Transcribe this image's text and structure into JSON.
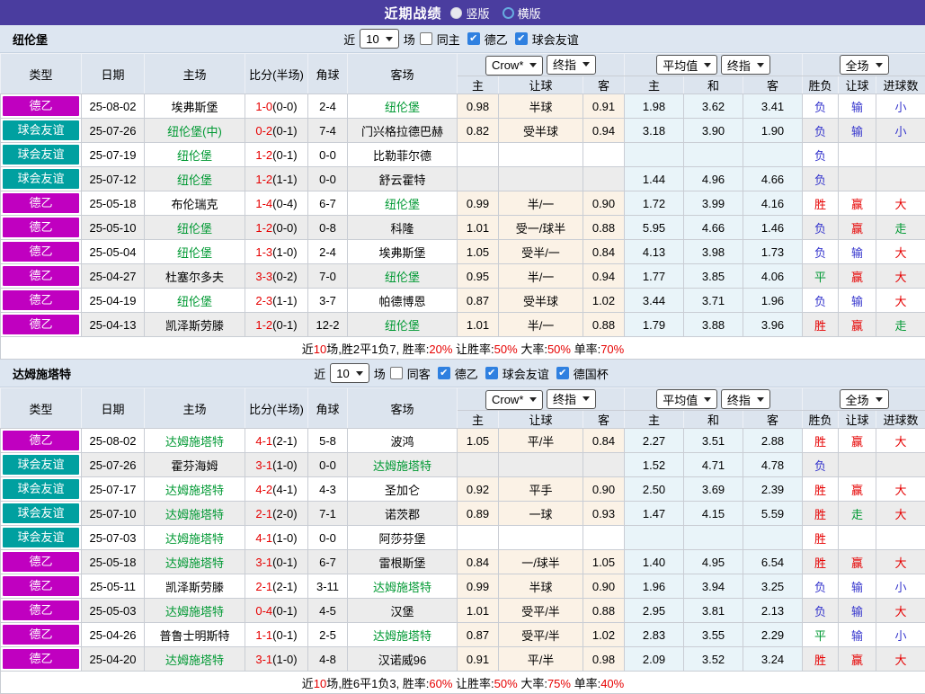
{
  "header": {
    "title": "近期战绩",
    "radios": [
      {
        "label": "竖版",
        "checked": true
      },
      {
        "label": "横版",
        "checked": false
      }
    ]
  },
  "colors": {
    "topbar": "#4a3d9f",
    "band_bg": "#dde6f1",
    "header_bg": "#dce4ee",
    "score_red": "#e60000",
    "team_green": "#009933",
    "win_red": "#e60000",
    "lose_blue": "#3535cd",
    "draw_green": "#009933",
    "odds_cream_bg": "#fbf2e6",
    "avg_blue_bg": "#e9f4f9"
  },
  "league_colors": {
    "德乙": "#c000c0",
    "球会友谊": "#00a0a0"
  },
  "columns": {
    "left": [
      "类型",
      "日期",
      "主场",
      "比分(半场)",
      "角球",
      "客场"
    ],
    "group1": [
      "主",
      "让球",
      "客"
    ],
    "group2": [
      "主",
      "和",
      "客"
    ],
    "group3": [
      "胜负",
      "让球",
      "进球数"
    ]
  },
  "sections": [
    {
      "team": "纽伦堡",
      "controls": {
        "near": "近",
        "count": "10",
        "unit": "场"
      },
      "checkboxes": [
        {
          "label": "同主",
          "checked": false
        },
        {
          "label": "德乙",
          "checked": true
        },
        {
          "label": "球会友谊",
          "checked": true
        }
      ],
      "dropdowns": {
        "book": "Crow*",
        "final1": "终指",
        "avg": "平均值",
        "final2": "终指",
        "full": "全场"
      },
      "rows": [
        {
          "lg": "德乙",
          "dt": "25-08-02",
          "hm": "埃弗斯堡",
          "hg": false,
          "fs": "1-0",
          "hf": "(0-0)",
          "cn": "2-4",
          "aw": "纽伦堡",
          "ag": true,
          "o1": "0.98",
          "hd": "半球",
          "o2": "0.91",
          "a1": "1.98",
          "a2": "3.62",
          "a3": "3.41",
          "w": "负",
          "wc": "b",
          "h": "输",
          "hc": "b",
          "g": "小",
          "gc": "b"
        },
        {
          "lg": "球会友谊",
          "dt": "25-07-26",
          "hm": "纽伦堡(中)",
          "hg": true,
          "fs": "0-2",
          "hf": "(0-1)",
          "cn": "7-4",
          "aw": "门兴格拉德巴赫",
          "ag": false,
          "o1": "0.82",
          "hd": "受半球",
          "o2": "0.94",
          "a1": "3.18",
          "a2": "3.90",
          "a3": "1.90",
          "w": "负",
          "wc": "b",
          "h": "输",
          "hc": "b",
          "g": "小",
          "gc": "b"
        },
        {
          "lg": "球会友谊",
          "dt": "25-07-19",
          "hm": "纽伦堡",
          "hg": true,
          "fs": "1-2",
          "hf": "(0-1)",
          "cn": "0-0",
          "aw": "比勒菲尔德",
          "ag": false,
          "o1": "",
          "hd": "",
          "o2": "",
          "a1": "",
          "a2": "",
          "a3": "",
          "w": "负",
          "wc": "b",
          "h": "",
          "hc": "",
          "g": "",
          "gc": ""
        },
        {
          "lg": "球会友谊",
          "dt": "25-07-12",
          "hm": "纽伦堡",
          "hg": true,
          "fs": "1-2",
          "hf": "(1-1)",
          "cn": "0-0",
          "aw": "舒云霍特",
          "ag": false,
          "o1": "",
          "hd": "",
          "o2": "",
          "a1": "1.44",
          "a2": "4.96",
          "a3": "4.66",
          "w": "负",
          "wc": "b",
          "h": "",
          "hc": "",
          "g": "",
          "gc": ""
        },
        {
          "lg": "德乙",
          "dt": "25-05-18",
          "hm": "布伦瑞克",
          "hg": false,
          "fs": "1-4",
          "hf": "(0-4)",
          "cn": "6-7",
          "aw": "纽伦堡",
          "ag": true,
          "o1": "0.99",
          "hd": "半/一",
          "o2": "0.90",
          "a1": "1.72",
          "a2": "3.99",
          "a3": "4.16",
          "w": "胜",
          "wc": "r",
          "h": "赢",
          "hc": "r",
          "g": "大",
          "gc": "r"
        },
        {
          "lg": "德乙",
          "dt": "25-05-10",
          "hm": "纽伦堡",
          "hg": true,
          "fs": "1-2",
          "hf": "(0-0)",
          "cn": "0-8",
          "aw": "科隆",
          "ag": false,
          "o1": "1.01",
          "hd": "受一/球半",
          "o2": "0.88",
          "a1": "5.95",
          "a2": "4.66",
          "a3": "1.46",
          "w": "负",
          "wc": "b",
          "h": "赢",
          "hc": "r",
          "g": "走",
          "gc": "g"
        },
        {
          "lg": "德乙",
          "dt": "25-05-04",
          "hm": "纽伦堡",
          "hg": true,
          "fs": "1-3",
          "hf": "(1-0)",
          "cn": "2-4",
          "aw": "埃弗斯堡",
          "ag": false,
          "o1": "1.05",
          "hd": "受半/一",
          "o2": "0.84",
          "a1": "4.13",
          "a2": "3.98",
          "a3": "1.73",
          "w": "负",
          "wc": "b",
          "h": "输",
          "hc": "b",
          "g": "大",
          "gc": "r"
        },
        {
          "lg": "德乙",
          "dt": "25-04-27",
          "hm": "杜塞尔多夫",
          "hg": false,
          "fs": "3-3",
          "hf": "(0-2)",
          "cn": "7-0",
          "aw": "纽伦堡",
          "ag": true,
          "o1": "0.95",
          "hd": "半/一",
          "o2": "0.94",
          "a1": "1.77",
          "a2": "3.85",
          "a3": "4.06",
          "w": "平",
          "wc": "g",
          "h": "赢",
          "hc": "r",
          "g": "大",
          "gc": "r"
        },
        {
          "lg": "德乙",
          "dt": "25-04-19",
          "hm": "纽伦堡",
          "hg": true,
          "fs": "2-3",
          "hf": "(1-1)",
          "cn": "3-7",
          "aw": "帕德博恩",
          "ag": false,
          "o1": "0.87",
          "hd": "受半球",
          "o2": "1.02",
          "a1": "3.44",
          "a2": "3.71",
          "a3": "1.96",
          "w": "负",
          "wc": "b",
          "h": "输",
          "hc": "b",
          "g": "大",
          "gc": "r"
        },
        {
          "lg": "德乙",
          "dt": "25-04-13",
          "hm": "凯泽斯劳滕",
          "hg": false,
          "fs": "1-2",
          "hf": "(0-1)",
          "cn": "12-2",
          "aw": "纽伦堡",
          "ag": true,
          "o1": "1.01",
          "hd": "半/一",
          "o2": "0.88",
          "a1": "1.79",
          "a2": "3.88",
          "a3": "3.96",
          "w": "胜",
          "wc": "r",
          "h": "赢",
          "hc": "r",
          "g": "走",
          "gc": "g"
        }
      ],
      "summary": [
        {
          "t": "近"
        },
        {
          "t": "10",
          "r": true
        },
        {
          "t": "场,胜2平1负7, 胜率:"
        },
        {
          "t": "20%",
          "r": true
        },
        {
          "t": " 让胜率:"
        },
        {
          "t": "50%",
          "r": true
        },
        {
          "t": " 大率:"
        },
        {
          "t": "50%",
          "r": true
        },
        {
          "t": " 单率:"
        },
        {
          "t": "70%",
          "r": true
        }
      ]
    },
    {
      "team": "达姆施塔特",
      "controls": {
        "near": "近",
        "count": "10",
        "unit": "场"
      },
      "checkboxes": [
        {
          "label": "同客",
          "checked": false
        },
        {
          "label": "德乙",
          "checked": true
        },
        {
          "label": "球会友谊",
          "checked": true
        },
        {
          "label": "德国杯",
          "checked": true
        }
      ],
      "dropdowns": {
        "book": "Crow*",
        "final1": "终指",
        "avg": "平均值",
        "final2": "终指",
        "full": "全场"
      },
      "rows": [
        {
          "lg": "德乙",
          "dt": "25-08-02",
          "hm": "达姆施塔特",
          "hg": true,
          "fs": "4-1",
          "hf": "(2-1)",
          "cn": "5-8",
          "aw": "波鸿",
          "ag": false,
          "o1": "1.05",
          "hd": "平/半",
          "o2": "0.84",
          "a1": "2.27",
          "a2": "3.51",
          "a3": "2.88",
          "w": "胜",
          "wc": "r",
          "h": "赢",
          "hc": "r",
          "g": "大",
          "gc": "r"
        },
        {
          "lg": "球会友谊",
          "dt": "25-07-26",
          "hm": "霍芬海姆",
          "hg": false,
          "fs": "3-1",
          "hf": "(1-0)",
          "cn": "0-0",
          "aw": "达姆施塔特",
          "ag": true,
          "o1": "",
          "hd": "",
          "o2": "",
          "a1": "1.52",
          "a2": "4.71",
          "a3": "4.78",
          "w": "负",
          "wc": "b",
          "h": "",
          "hc": "",
          "g": "",
          "gc": ""
        },
        {
          "lg": "球会友谊",
          "dt": "25-07-17",
          "hm": "达姆施塔特",
          "hg": true,
          "fs": "4-2",
          "hf": "(4-1)",
          "cn": "4-3",
          "aw": "圣加仑",
          "ag": false,
          "o1": "0.92",
          "hd": "平手",
          "o2": "0.90",
          "a1": "2.50",
          "a2": "3.69",
          "a3": "2.39",
          "w": "胜",
          "wc": "r",
          "h": "赢",
          "hc": "r",
          "g": "大",
          "gc": "r"
        },
        {
          "lg": "球会友谊",
          "dt": "25-07-10",
          "hm": "达姆施塔特",
          "hg": true,
          "fs": "2-1",
          "hf": "(2-0)",
          "cn": "7-1",
          "aw": "诺茨郡",
          "ag": false,
          "o1": "0.89",
          "hd": "一球",
          "o2": "0.93",
          "a1": "1.47",
          "a2": "4.15",
          "a3": "5.59",
          "w": "胜",
          "wc": "r",
          "h": "走",
          "hc": "g",
          "g": "大",
          "gc": "r"
        },
        {
          "lg": "球会友谊",
          "dt": "25-07-03",
          "hm": "达姆施塔特",
          "hg": true,
          "fs": "4-1",
          "hf": "(1-0)",
          "cn": "0-0",
          "aw": "阿莎芬堡",
          "ag": false,
          "o1": "",
          "hd": "",
          "o2": "",
          "a1": "",
          "a2": "",
          "a3": "",
          "w": "胜",
          "wc": "r",
          "h": "",
          "hc": "",
          "g": "",
          "gc": ""
        },
        {
          "lg": "德乙",
          "dt": "25-05-18",
          "hm": "达姆施塔特",
          "hg": true,
          "fs": "3-1",
          "hf": "(0-1)",
          "cn": "6-7",
          "aw": "雷根斯堡",
          "ag": false,
          "o1": "0.84",
          "hd": "一/球半",
          "o2": "1.05",
          "a1": "1.40",
          "a2": "4.95",
          "a3": "6.54",
          "w": "胜",
          "wc": "r",
          "h": "赢",
          "hc": "r",
          "g": "大",
          "gc": "r"
        },
        {
          "lg": "德乙",
          "dt": "25-05-11",
          "hm": "凯泽斯劳滕",
          "hg": false,
          "fs": "2-1",
          "hf": "(2-1)",
          "cn": "3-11",
          "aw": "达姆施塔特",
          "ag": true,
          "o1": "0.99",
          "hd": "半球",
          "o2": "0.90",
          "a1": "1.96",
          "a2": "3.94",
          "a3": "3.25",
          "w": "负",
          "wc": "b",
          "h": "输",
          "hc": "b",
          "g": "小",
          "gc": "b"
        },
        {
          "lg": "德乙",
          "dt": "25-05-03",
          "hm": "达姆施塔特",
          "hg": true,
          "fs": "0-4",
          "hf": "(0-1)",
          "cn": "4-5",
          "aw": "汉堡",
          "ag": false,
          "o1": "1.01",
          "hd": "受平/半",
          "o2": "0.88",
          "a1": "2.95",
          "a2": "3.81",
          "a3": "2.13",
          "w": "负",
          "wc": "b",
          "h": "输",
          "hc": "b",
          "g": "大",
          "gc": "r"
        },
        {
          "lg": "德乙",
          "dt": "25-04-26",
          "hm": "普鲁士明斯特",
          "hg": false,
          "fs": "1-1",
          "hf": "(0-1)",
          "cn": "2-5",
          "aw": "达姆施塔特",
          "ag": true,
          "o1": "0.87",
          "hd": "受平/半",
          "o2": "1.02",
          "a1": "2.83",
          "a2": "3.55",
          "a3": "2.29",
          "w": "平",
          "wc": "g",
          "h": "输",
          "hc": "b",
          "g": "小",
          "gc": "b"
        },
        {
          "lg": "德乙",
          "dt": "25-04-20",
          "hm": "达姆施塔特",
          "hg": true,
          "fs": "3-1",
          "hf": "(1-0)",
          "cn": "4-8",
          "aw": "汉诺威96",
          "ag": false,
          "o1": "0.91",
          "hd": "平/半",
          "o2": "0.98",
          "a1": "2.09",
          "a2": "3.52",
          "a3": "3.24",
          "w": "胜",
          "wc": "r",
          "h": "赢",
          "hc": "r",
          "g": "大",
          "gc": "r"
        }
      ],
      "summary": [
        {
          "t": "近"
        },
        {
          "t": "10",
          "r": true
        },
        {
          "t": "场,胜6平1负3, 胜率:"
        },
        {
          "t": "60%",
          "r": true
        },
        {
          "t": " 让胜率:"
        },
        {
          "t": "50%",
          "r": true
        },
        {
          "t": " 大率:"
        },
        {
          "t": "75%",
          "r": true
        },
        {
          "t": " 单率:"
        },
        {
          "t": "40%",
          "r": true
        }
      ]
    }
  ]
}
